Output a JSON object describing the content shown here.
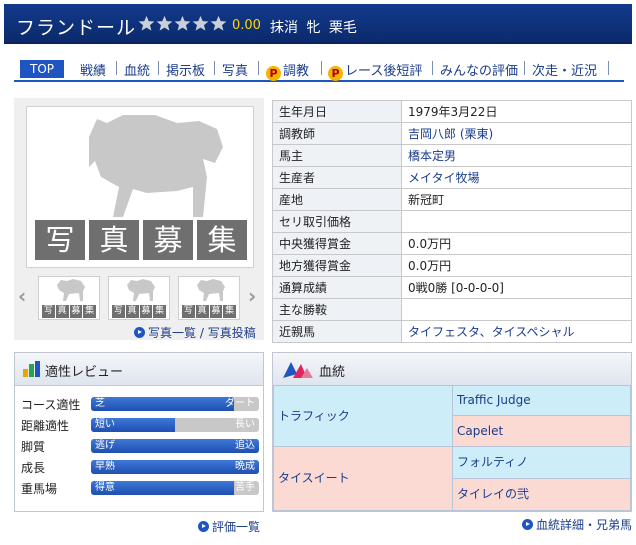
{
  "header": {
    "horse_name": "フランドール",
    "rating_score": "0.00",
    "stars": 5,
    "status": "抹消 牝 栗毛",
    "colors": {
      "bar": "#0b2a6b",
      "score": "#ffd800"
    }
  },
  "nav": {
    "top": "TOP",
    "items": [
      "戦績",
      "血統",
      "掲示板",
      "写真",
      "調教",
      "レース後短評",
      "みんなの評価",
      "次走・近況"
    ],
    "premium_mark": "P"
  },
  "photo": {
    "placeholder": "写真募集",
    "thumb_placeholder": "写真募集",
    "links": [
      "写真一覧",
      "写真投稿"
    ],
    "link_separator": "/"
  },
  "profile": [
    {
      "label": "生年月日",
      "value": "1979年3月22日",
      "link": false
    },
    {
      "label": "調教師",
      "value": "吉岡八郎 (栗東)",
      "link": true
    },
    {
      "label": "馬主",
      "value": "橋本定男",
      "link": true
    },
    {
      "label": "生産者",
      "value": "メイタイ牧場",
      "link": true
    },
    {
      "label": "産地",
      "value": "新冠町",
      "link": false
    },
    {
      "label": "セリ取引価格",
      "value": "",
      "link": false
    },
    {
      "label": "中央獲得賞金",
      "value": "0.0万円",
      "link": false
    },
    {
      "label": "地方獲得賞金",
      "value": "0.0万円",
      "link": false
    },
    {
      "label": "通算成績",
      "value": "0戦0勝 [0-0-0-0]",
      "link": false
    },
    {
      "label": "主な勝鞍",
      "value": "",
      "link": false
    },
    {
      "label": "近親馬",
      "value": "タイフェスタ、タイスペシャル",
      "link": true
    }
  ],
  "aptitude": {
    "title": "適性レビュー",
    "rows": [
      {
        "label": "コース適性",
        "left": "芝",
        "right": "ダート",
        "level": 0.85
      },
      {
        "label": "距離適性",
        "left": "短い",
        "right": "長い",
        "level": 0.5
      },
      {
        "label": "脚質",
        "left": "逃げ",
        "right": "追込",
        "level": 1.0
      },
      {
        "label": "成長",
        "left": "早熟",
        "right": "晩成",
        "level": 1.0
      },
      {
        "label": "重馬場",
        "left": "得意",
        "right": "苦手",
        "level": 0.85
      }
    ],
    "footer_link": "評価一覧"
  },
  "pedigree": {
    "title": "血統",
    "sire": "トラフィック",
    "sire_sire": "Traffic Judge",
    "sire_dam": "Capelet",
    "dam": "タイスイート",
    "dam_sire": "フォルティノ",
    "dam_dam": "タイレイの弐",
    "footer_link": "血統詳細・兄弟馬"
  }
}
